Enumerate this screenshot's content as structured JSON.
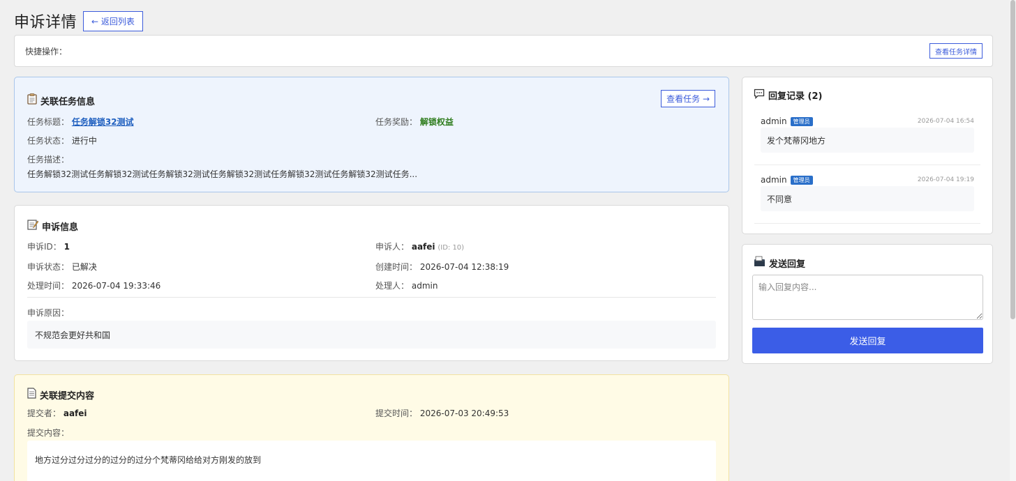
{
  "page": {
    "title": "申诉详情",
    "back_label": "← 返回列表"
  },
  "quick_bar": {
    "label": "快捷操作：",
    "view_task_detail_label": "查看任务详情"
  },
  "task_card": {
    "title": "关联任务信息",
    "view_task_label": "查看任务 →",
    "task_title_label": "任务标题：",
    "task_title": "任务解锁32测试",
    "reward_label": "任务奖励：",
    "reward": "解锁权益",
    "status_label": "任务状态：",
    "status": "进行中",
    "desc_label": "任务描述：",
    "desc": "任务解锁32测试任务解锁32测试任务解锁32测试任务解锁32测试任务解锁32测试任务解锁32测试任务..."
  },
  "appeal_card": {
    "title": "申诉信息",
    "id_label": "申诉ID：",
    "id": "1",
    "appellant_label": "申诉人：",
    "appellant": "aafei",
    "appellant_id": "(ID: 10)",
    "status_label": "申诉状态：",
    "status": "已解决",
    "created_label": "创建时间：",
    "created": "2026-07-04 12:38:19",
    "handled_label": "处理时间：",
    "handled": "2026-07-04 19:33:46",
    "handler_label": "处理人：",
    "handler": "admin",
    "reason_label": "申诉原因：",
    "reason": "不规范会更好共和国"
  },
  "submission_card": {
    "title": "关联提交内容",
    "submitter_label": "提交者：",
    "submitter": "aafei",
    "submit_time_label": "提交时间：",
    "submit_time": "2026-07-03 20:49:53",
    "content_label": "提交内容：",
    "content": "地方过分过分过分的过分的过分个梵蒂冈给给对方刚发的放到"
  },
  "reply_card": {
    "title": "回复记录 (2)",
    "items": [
      {
        "user": "admin",
        "badge": "管理员",
        "time": "2026-07-04 16:54",
        "text": "发个梵蒂冈地方"
      },
      {
        "user": "admin",
        "badge": "管理员",
        "time": "2026-07-04 19:19",
        "text": "不同意"
      }
    ]
  },
  "send_card": {
    "title": "发送回复",
    "placeholder": "输入回复内容...",
    "send_label": "发送回复"
  },
  "colors": {
    "primary": "#3b5de7",
    "link": "#1f5fbf",
    "reward": "#2f7d1e",
    "badge": "#2a6fc9"
  }
}
